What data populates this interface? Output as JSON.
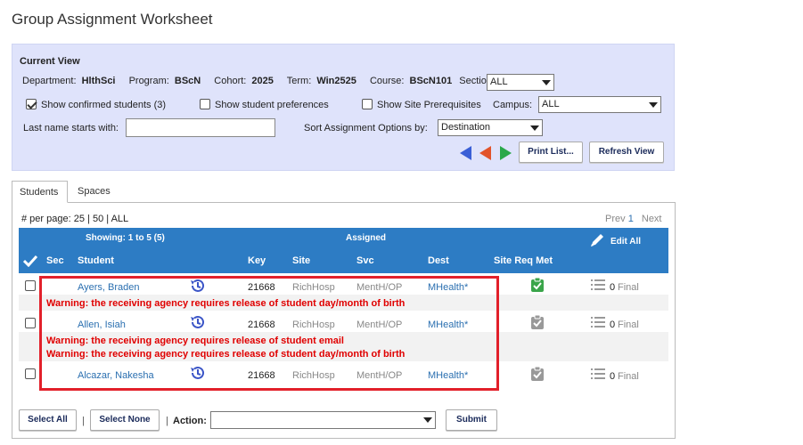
{
  "page": {
    "title": "Group Assignment Worksheet"
  },
  "current_view": {
    "heading": "Current View",
    "department_label": "Department:",
    "department_value": "HlthSci",
    "program_label": "Program:",
    "program_value": "BScN",
    "cohort_label": "Cohort:",
    "cohort_value": "2025",
    "term_label": "Term:",
    "term_value": "Win2525",
    "course_label": "Course:",
    "course_value": "BScN101",
    "section_label": "Section:",
    "section_value": "ALL",
    "show_confirmed_label": "Show confirmed students (3)",
    "show_confirmed_checked": true,
    "show_preferences_label": "Show student preferences",
    "show_preferences_checked": false,
    "show_prereq_label": "Show Site Prerequisites",
    "show_prereq_checked": false,
    "campus_label": "Campus:",
    "campus_value": "ALL",
    "lastname_label": "Last name starts with:",
    "lastname_value": "",
    "sort_label": "Sort Assignment Options by:",
    "sort_value": "Destination",
    "print_label": "Print List...",
    "refresh_label": "Refresh View",
    "arrow_colors": {
      "left": "#3a5fd6",
      "middle": "#e2532a",
      "right": "#2aa84a"
    }
  },
  "tabs": [
    {
      "label": "Students",
      "active": true
    },
    {
      "label": "Spaces",
      "active": false
    }
  ],
  "paging": {
    "per_page_label": "# per page:",
    "opt25": "25",
    "sep": "|",
    "opt50": "50",
    "optall": "ALL",
    "prev": "Prev",
    "current": "1",
    "next": "Next"
  },
  "table": {
    "showing": "Showing: 1 to 5 (5)",
    "assigned": "Assigned",
    "edit_all": "Edit All",
    "columns": {
      "sec": "Sec",
      "student": "Student",
      "key": "Key",
      "site": "Site",
      "svc": "Svc",
      "dest": "Dest",
      "sitereq": "Site Req Met"
    },
    "rows": [
      {
        "student": "Ayers, Braden",
        "key": "21668",
        "site": "RichHosp",
        "svc": "MentH/OP",
        "dest": "MHealth*",
        "site_req_met": true,
        "count": "0",
        "status": "Final",
        "warnings": [
          "Warning: the receiving agency requires release of student day/month of birth"
        ]
      },
      {
        "student": "Allen, Isiah",
        "key": "21668",
        "site": "RichHosp",
        "svc": "MentH/OP",
        "dest": "MHealth*",
        "site_req_met": false,
        "count": "0",
        "status": "Final",
        "warnings": [
          "Warning: the receiving agency requires release of student email",
          "Warning: the receiving agency requires release of student day/month of birth"
        ]
      },
      {
        "student": "Alcazar, Nakesha",
        "key": "21668",
        "site": "RichHosp",
        "svc": "MentH/OP",
        "dest": "MHealth*",
        "site_req_met": false,
        "count": "0",
        "status": "Final",
        "warnings": []
      }
    ]
  },
  "footer": {
    "select_all": "Select All",
    "sep": "|",
    "select_none": "Select None",
    "action_prefix": "|",
    "action_label": "Action:",
    "action_value": "",
    "submit": "Submit"
  }
}
